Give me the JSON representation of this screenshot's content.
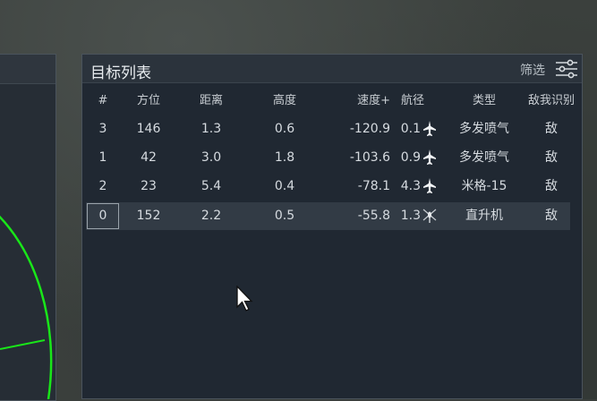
{
  "panel": {
    "title": "目标列表",
    "filter_label": "筛选"
  },
  "table": {
    "headers": [
      "#",
      "方位",
      "距离",
      "高度",
      "速度+",
      "航径",
      "类型",
      "敌我识别"
    ],
    "rows": [
      {
        "idx": "3",
        "bearing": "146",
        "distance": "1.3",
        "altitude": "0.6",
        "speed": "-120.9",
        "course": "0.1",
        "icon": "jet-icon",
        "type": "多发喷气",
        "iff": "敌",
        "selected": false
      },
      {
        "idx": "1",
        "bearing": "42",
        "distance": "3.0",
        "altitude": "1.8",
        "speed": "-103.6",
        "course": "0.9",
        "icon": "jet-icon",
        "type": "多发喷气",
        "iff": "敌",
        "selected": false
      },
      {
        "idx": "2",
        "bearing": "23",
        "distance": "5.4",
        "altitude": "0.4",
        "speed": "-78.1",
        "course": "4.3",
        "icon": "jet-icon",
        "type": "米格-15",
        "iff": "敌",
        "selected": false
      },
      {
        "idx": "0",
        "bearing": "152",
        "distance": "2.2",
        "altitude": "0.5",
        "speed": "-55.8",
        "course": "1.3",
        "icon": "helicopter-icon",
        "type": "直升机",
        "iff": "敌",
        "selected": true
      }
    ]
  },
  "colors": {
    "panel_bg": "#202832",
    "header_bg": "#2b333c",
    "selected_row": "#323b45",
    "radar_green": "#19e619"
  }
}
